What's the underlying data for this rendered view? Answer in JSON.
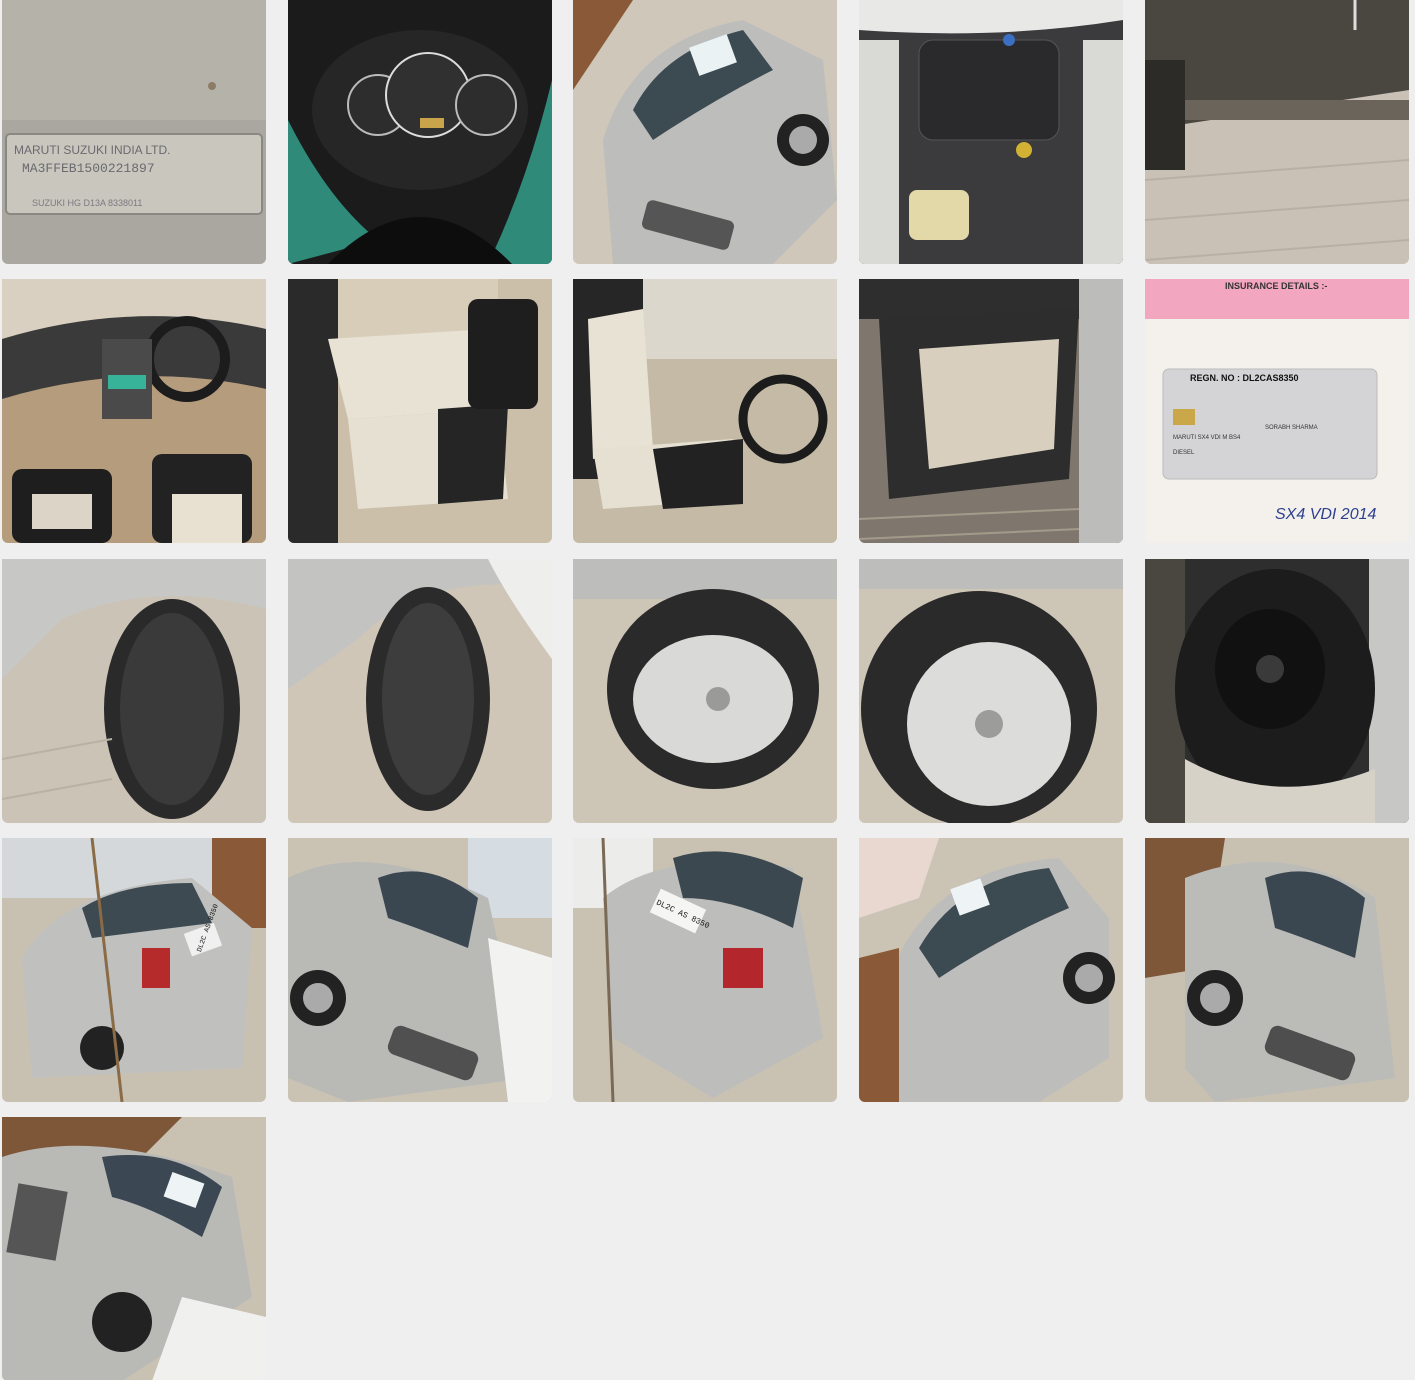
{
  "colors": {
    "page_bg": "#efefef",
    "silver": "#b9b9b6",
    "dark_interior": "#2c2c2c",
    "cream_seat": "#e6e0d2",
    "insurance_pink": "#f2a6c0"
  },
  "photos": {
    "vin": {
      "label_line1": "MARUTI SUZUKI INDIA LTD.",
      "label_line2": "MA3FFEB1500221897",
      "label_line3": "SUZUKI HG D13A 8338011"
    },
    "rc": {
      "header": "INSURANCE DETAILS :-",
      "regn": "REGN. NO : DL2CAS8350",
      "model_line": "MARUTI SX4 VDI M BS4",
      "owner": "SORABH SHARMA",
      "fuel": "DIESEL",
      "handwriting": "SX4 VDI 2014"
    },
    "plate": "DL2C AS 8350"
  }
}
